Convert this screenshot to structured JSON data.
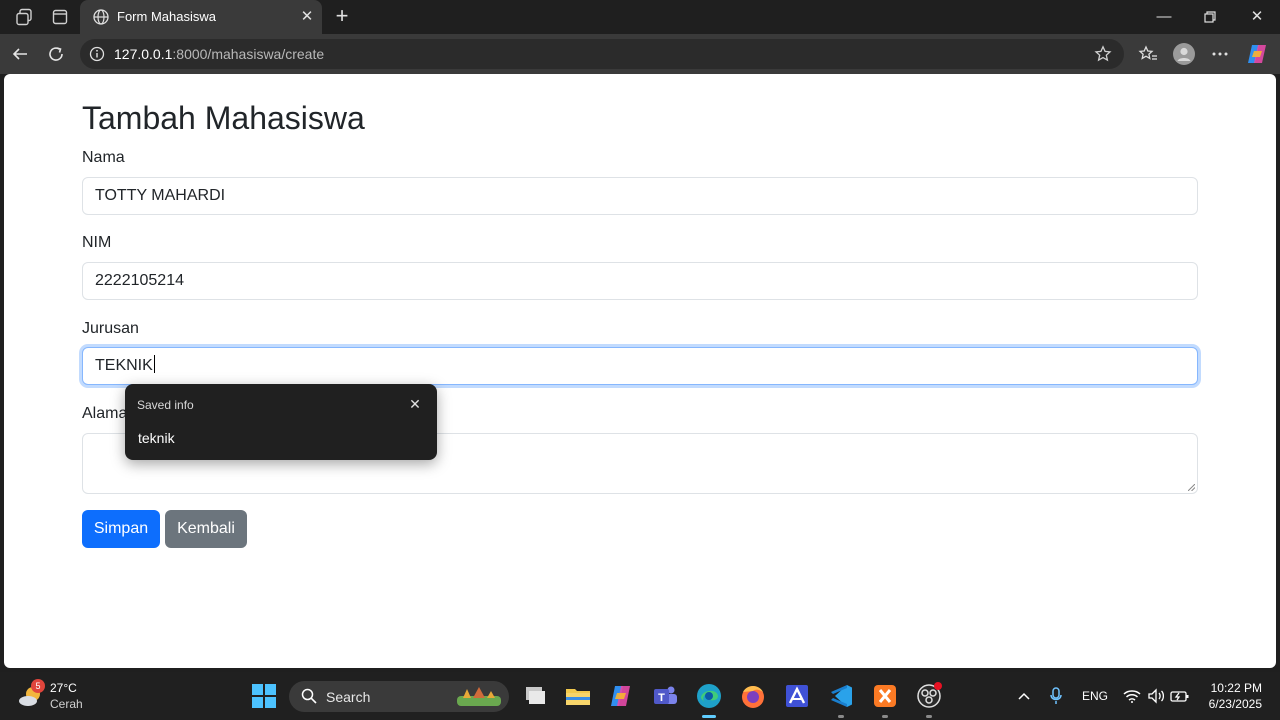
{
  "browser": {
    "tab_title": "Form Mahasiswa",
    "url_host": "127.0.0.1",
    "url_rest": ":8000/mahasiswa/create"
  },
  "form": {
    "title": "Tambah Mahasiswa",
    "fields": [
      {
        "label": "Nama",
        "value": "TOTTY MAHARDI"
      },
      {
        "label": "NIM",
        "value": "2222105214"
      },
      {
        "label": "Jurusan",
        "value": "TEKNIK"
      },
      {
        "label": "Alamat",
        "value": ""
      }
    ],
    "alamat_label_visible": "Alama",
    "submit_label": "Simpan",
    "back_label": "Kembali"
  },
  "autofill": {
    "title": "Saved info",
    "suggestion": "teknik"
  },
  "taskbar": {
    "weather_temp": "27°C",
    "weather_desc": "Cerah",
    "weather_badge": "5",
    "search_label": "Search",
    "language": "ENG",
    "time": "10:22 PM",
    "date": "6/23/2025"
  },
  "colors": {
    "primary": "#0d6efd",
    "secondary": "#6c757d",
    "focus_border": "#86b7fe"
  }
}
